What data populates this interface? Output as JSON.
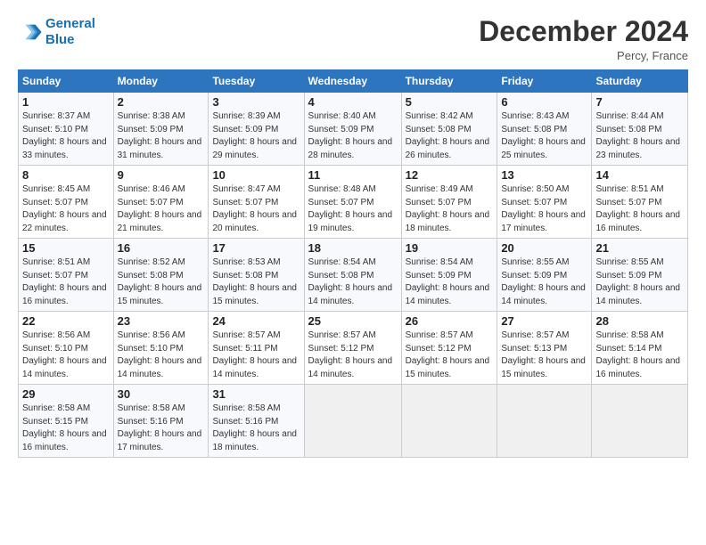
{
  "header": {
    "logo_line1": "General",
    "logo_line2": "Blue",
    "month": "December 2024",
    "location": "Percy, France"
  },
  "weekdays": [
    "Sunday",
    "Monday",
    "Tuesday",
    "Wednesday",
    "Thursday",
    "Friday",
    "Saturday"
  ],
  "weeks": [
    [
      {
        "day": "1",
        "sunrise": "Sunrise: 8:37 AM",
        "sunset": "Sunset: 5:10 PM",
        "daylight": "Daylight: 8 hours and 33 minutes."
      },
      {
        "day": "2",
        "sunrise": "Sunrise: 8:38 AM",
        "sunset": "Sunset: 5:09 PM",
        "daylight": "Daylight: 8 hours and 31 minutes."
      },
      {
        "day": "3",
        "sunrise": "Sunrise: 8:39 AM",
        "sunset": "Sunset: 5:09 PM",
        "daylight": "Daylight: 8 hours and 29 minutes."
      },
      {
        "day": "4",
        "sunrise": "Sunrise: 8:40 AM",
        "sunset": "Sunset: 5:09 PM",
        "daylight": "Daylight: 8 hours and 28 minutes."
      },
      {
        "day": "5",
        "sunrise": "Sunrise: 8:42 AM",
        "sunset": "Sunset: 5:08 PM",
        "daylight": "Daylight: 8 hours and 26 minutes."
      },
      {
        "day": "6",
        "sunrise": "Sunrise: 8:43 AM",
        "sunset": "Sunset: 5:08 PM",
        "daylight": "Daylight: 8 hours and 25 minutes."
      },
      {
        "day": "7",
        "sunrise": "Sunrise: 8:44 AM",
        "sunset": "Sunset: 5:08 PM",
        "daylight": "Daylight: 8 hours and 23 minutes."
      }
    ],
    [
      {
        "day": "8",
        "sunrise": "Sunrise: 8:45 AM",
        "sunset": "Sunset: 5:07 PM",
        "daylight": "Daylight: 8 hours and 22 minutes."
      },
      {
        "day": "9",
        "sunrise": "Sunrise: 8:46 AM",
        "sunset": "Sunset: 5:07 PM",
        "daylight": "Daylight: 8 hours and 21 minutes."
      },
      {
        "day": "10",
        "sunrise": "Sunrise: 8:47 AM",
        "sunset": "Sunset: 5:07 PM",
        "daylight": "Daylight: 8 hours and 20 minutes."
      },
      {
        "day": "11",
        "sunrise": "Sunrise: 8:48 AM",
        "sunset": "Sunset: 5:07 PM",
        "daylight": "Daylight: 8 hours and 19 minutes."
      },
      {
        "day": "12",
        "sunrise": "Sunrise: 8:49 AM",
        "sunset": "Sunset: 5:07 PM",
        "daylight": "Daylight: 8 hours and 18 minutes."
      },
      {
        "day": "13",
        "sunrise": "Sunrise: 8:50 AM",
        "sunset": "Sunset: 5:07 PM",
        "daylight": "Daylight: 8 hours and 17 minutes."
      },
      {
        "day": "14",
        "sunrise": "Sunrise: 8:51 AM",
        "sunset": "Sunset: 5:07 PM",
        "daylight": "Daylight: 8 hours and 16 minutes."
      }
    ],
    [
      {
        "day": "15",
        "sunrise": "Sunrise: 8:51 AM",
        "sunset": "Sunset: 5:07 PM",
        "daylight": "Daylight: 8 hours and 16 minutes."
      },
      {
        "day": "16",
        "sunrise": "Sunrise: 8:52 AM",
        "sunset": "Sunset: 5:08 PM",
        "daylight": "Daylight: 8 hours and 15 minutes."
      },
      {
        "day": "17",
        "sunrise": "Sunrise: 8:53 AM",
        "sunset": "Sunset: 5:08 PM",
        "daylight": "Daylight: 8 hours and 15 minutes."
      },
      {
        "day": "18",
        "sunrise": "Sunrise: 8:54 AM",
        "sunset": "Sunset: 5:08 PM",
        "daylight": "Daylight: 8 hours and 14 minutes."
      },
      {
        "day": "19",
        "sunrise": "Sunrise: 8:54 AM",
        "sunset": "Sunset: 5:09 PM",
        "daylight": "Daylight: 8 hours and 14 minutes."
      },
      {
        "day": "20",
        "sunrise": "Sunrise: 8:55 AM",
        "sunset": "Sunset: 5:09 PM",
        "daylight": "Daylight: 8 hours and 14 minutes."
      },
      {
        "day": "21",
        "sunrise": "Sunrise: 8:55 AM",
        "sunset": "Sunset: 5:09 PM",
        "daylight": "Daylight: 8 hours and 14 minutes."
      }
    ],
    [
      {
        "day": "22",
        "sunrise": "Sunrise: 8:56 AM",
        "sunset": "Sunset: 5:10 PM",
        "daylight": "Daylight: 8 hours and 14 minutes."
      },
      {
        "day": "23",
        "sunrise": "Sunrise: 8:56 AM",
        "sunset": "Sunset: 5:10 PM",
        "daylight": "Daylight: 8 hours and 14 minutes."
      },
      {
        "day": "24",
        "sunrise": "Sunrise: 8:57 AM",
        "sunset": "Sunset: 5:11 PM",
        "daylight": "Daylight: 8 hours and 14 minutes."
      },
      {
        "day": "25",
        "sunrise": "Sunrise: 8:57 AM",
        "sunset": "Sunset: 5:12 PM",
        "daylight": "Daylight: 8 hours and 14 minutes."
      },
      {
        "day": "26",
        "sunrise": "Sunrise: 8:57 AM",
        "sunset": "Sunset: 5:12 PM",
        "daylight": "Daylight: 8 hours and 15 minutes."
      },
      {
        "day": "27",
        "sunrise": "Sunrise: 8:57 AM",
        "sunset": "Sunset: 5:13 PM",
        "daylight": "Daylight: 8 hours and 15 minutes."
      },
      {
        "day": "28",
        "sunrise": "Sunrise: 8:58 AM",
        "sunset": "Sunset: 5:14 PM",
        "daylight": "Daylight: 8 hours and 16 minutes."
      }
    ],
    [
      {
        "day": "29",
        "sunrise": "Sunrise: 8:58 AM",
        "sunset": "Sunset: 5:15 PM",
        "daylight": "Daylight: 8 hours and 16 minutes."
      },
      {
        "day": "30",
        "sunrise": "Sunrise: 8:58 AM",
        "sunset": "Sunset: 5:16 PM",
        "daylight": "Daylight: 8 hours and 17 minutes."
      },
      {
        "day": "31",
        "sunrise": "Sunrise: 8:58 AM",
        "sunset": "Sunset: 5:16 PM",
        "daylight": "Daylight: 8 hours and 18 minutes."
      },
      null,
      null,
      null,
      null
    ]
  ]
}
